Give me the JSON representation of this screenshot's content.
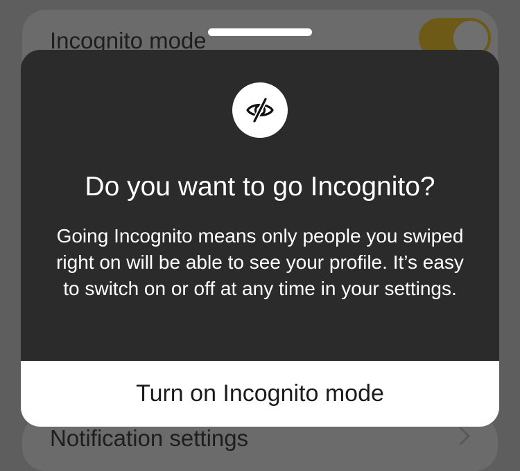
{
  "background": {
    "incognito_row": {
      "label": "Incognito mode",
      "toggle_on": true
    },
    "notification_row": {
      "label": "Notification settings"
    }
  },
  "modal": {
    "icon": "eye-slash-icon",
    "title": "Do you want to go Incognito?",
    "body": "Going Incognito means only people you swiped right on will be able to see your profile. It’s easy to switch on or off at any time in your settings.",
    "primary_button_label": "Turn on Incognito mode"
  },
  "colors": {
    "sheet_bg": "#2b2b2b",
    "dim_overlay": "#5e5e5e",
    "toggle_accent": "#6d5a16",
    "button_bg": "#ffffff"
  }
}
